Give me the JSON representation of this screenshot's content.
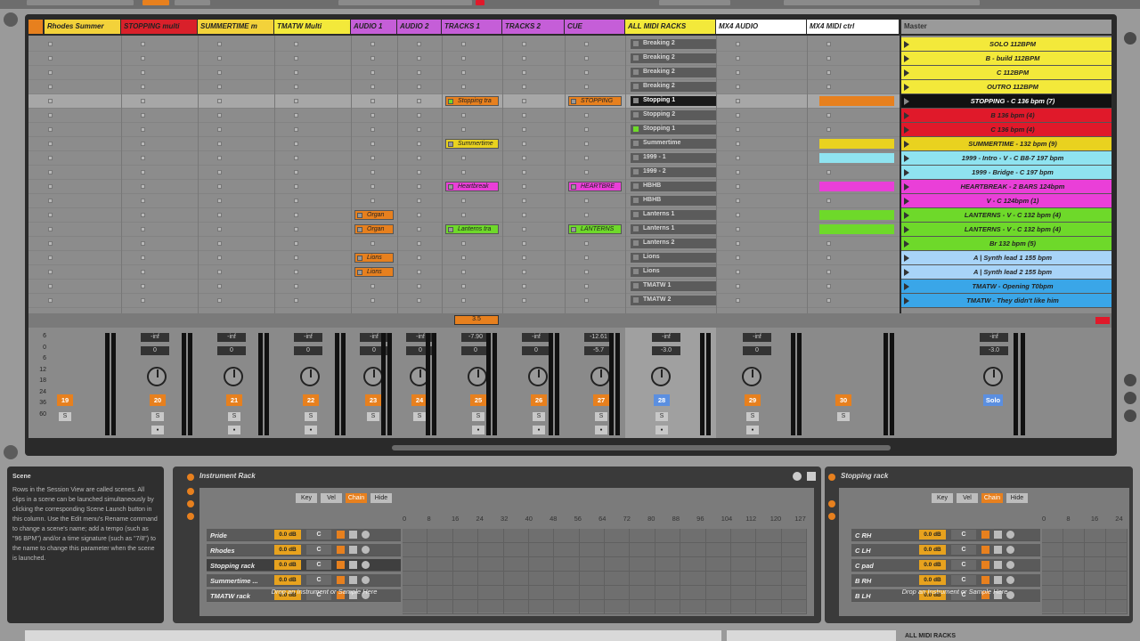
{
  "tracks": [
    {
      "name": "Rhodes Summer",
      "color": "#f3d23a",
      "num": "19",
      "vol": "",
      "pan": ""
    },
    {
      "name": "STOPPING multi",
      "color": "#d9202a",
      "num": "20",
      "vol": "-inf",
      "pan": "0"
    },
    {
      "name": "SUMMERTIME m",
      "color": "#f3d23a",
      "num": "21",
      "vol": "-inf",
      "pan": "0"
    },
    {
      "name": "TMATW Multi",
      "color": "#f3e93a",
      "num": "22",
      "vol": "-inf",
      "pan": "0"
    },
    {
      "name": "AUDIO 1",
      "color": "#c55ed8",
      "num": "23",
      "vol": "-inf",
      "pan": "0"
    },
    {
      "name": "AUDIO 2",
      "color": "#c55ed8",
      "num": "24",
      "vol": "-inf",
      "pan": "0"
    },
    {
      "name": "TRACKS 1",
      "color": "#c55ed8",
      "num": "25",
      "vol": "-7.90",
      "pan": "0"
    },
    {
      "name": "TRACKS 2",
      "color": "#c55ed8",
      "num": "26",
      "vol": "-inf",
      "pan": "0"
    },
    {
      "name": "CUE",
      "color": "#c55ed8",
      "num": "27",
      "vol": "-12.61",
      "pan": "-5.7"
    },
    {
      "name": "ALL MIDI RACKS",
      "color": "#f3e93a",
      "num": "28",
      "vol": "-inf",
      "pan": "-3.0"
    },
    {
      "name": "MX4 AUDIO",
      "color": "#ffffff",
      "num": "29",
      "vol": "-inf",
      "pan": "0"
    },
    {
      "name": "MX4 MIDI ctrl",
      "color": "#ffffff",
      "num": "30",
      "vol": "",
      "": ""
    }
  ],
  "master": {
    "label": "Master",
    "vol": "-inf",
    "pan": "-3.0",
    "solo_label": "Solo",
    "scenes": [
      {
        "name": "SOLO    112BPM",
        "color": "#f3e93a"
      },
      {
        "name": "B - build    112BPM",
        "color": "#f3e93a"
      },
      {
        "name": "C    112BPM",
        "color": "#f3e93a"
      },
      {
        "name": "OUTRO    112BPM",
        "color": "#f3e93a"
      },
      {
        "name": "STOPPING - C        136 bpm    (7)",
        "color": "#111111"
      },
      {
        "name": "B        136 bpm    (4)",
        "color": "#e0192a"
      },
      {
        "name": "C        136 bpm    (4)",
        "color": "#e0192a"
      },
      {
        "name": "SUMMERTIME -        132 bpm    (9)",
        "color": "#e9d21f"
      },
      {
        "name": "1999 - Intro - V - C        B8-7        197 bpm",
        "color": "#8fe3f0"
      },
      {
        "name": "1999 - Bridge - C        197 bpm",
        "color": "#8fe3f0"
      },
      {
        "name": "HEARTBREAK - 2 BARS        124bpm",
        "color": "#ea3fd8"
      },
      {
        "name": "V - C        124bpm    (1)",
        "color": "#ea3fd8"
      },
      {
        "name": "LANTERNS -    V - C        132 bpm    (4)",
        "color": "#6ed92a"
      },
      {
        "name": "LANTERNS -    V - C        132 bpm    (4)",
        "color": "#6ed92a"
      },
      {
        "name": "Br        132 bpm    (5)",
        "color": "#6ed92a"
      },
      {
        "name": "A | Synth lead 1        155 bpm",
        "color": "#a8d4f8"
      },
      {
        "name": "A | Synth lead 2        155 bpm",
        "color": "#a8d4f8"
      },
      {
        "name": "TMATW - Opening    T0bpm",
        "color": "#3aa6e8"
      },
      {
        "name": "TMATW - They didn't like him",
        "color": "#3aa6e8"
      }
    ]
  },
  "clips": {
    "col6": [
      {
        "row": 4,
        "label": "Stopping tra",
        "color": "#e7801e"
      },
      {
        "row": 7,
        "label": "Summertime",
        "color": "#e9d21f"
      },
      {
        "row": 10,
        "label": "Heartbreak",
        "color": "#ea3fd8"
      },
      {
        "row": 13,
        "label": "Lanterns tra",
        "color": "#6ed92a"
      }
    ],
    "col8": [
      {
        "row": 4,
        "label": "STOPPING",
        "color": "#e7801e"
      },
      {
        "row": 10,
        "label": "HEARTBRE",
        "color": "#ea3fd8"
      },
      {
        "row": 13,
        "label": "LANTERNS",
        "color": "#6ed92a"
      }
    ],
    "col4": [
      {
        "row": 12,
        "label": "Organ",
        "color": "#e7801e"
      },
      {
        "row": 13,
        "label": "Organ",
        "color": "#e7801e"
      },
      {
        "row": 15,
        "label": "Lions",
        "color": "#e7801e"
      },
      {
        "row": 16,
        "label": "Lions",
        "color": "#e7801e"
      }
    ],
    "midi": [
      {
        "row": 4,
        "color": "#e7801e"
      },
      {
        "row": 7,
        "color": "#e9d21f"
      },
      {
        "row": 8,
        "color": "#8fe3f0"
      },
      {
        "row": 10,
        "color": "#ea3fd8"
      },
      {
        "row": 12,
        "color": "#6ed92a"
      },
      {
        "row": 13,
        "color": "#6ed92a"
      }
    ],
    "racks": [
      "Breaking 2",
      "Breaking 2",
      "Breaking 2",
      "Breaking 2",
      "Stopping 1",
      "Stopping 2",
      "Stopping 1",
      "Summertime",
      "1999 - 1",
      "1999 - 2",
      "HBHB",
      "HBHB",
      "Lanterns 1",
      "Lanterns 1",
      "Lanterns 2",
      "Lions",
      "Lions",
      "TMATW 1",
      "TMATW 2"
    ]
  },
  "stop_clip_label": "3.5",
  "info": {
    "title": "Scene",
    "body": "Rows in the Session View are called scenes. All clips in a scene can be launched simultaneously by clicking the corresponding Scene Launch button in this column. Use the Edit menu's Rename command to change a scene's name; add a tempo (such as \"96 BPM\") and/or a time signature (such as \"7/8\") to the name to change this parameter when the scene is launched."
  },
  "instrument_rack": {
    "title": "Instrument Rack",
    "tabs": [
      "Key",
      "Vel",
      "Chain",
      "Hide"
    ],
    "chains": [
      "Pride",
      "Rhodes",
      "Stopping rack",
      "Summertime ...",
      "TMATW rack"
    ],
    "ruler": [
      "0",
      "8",
      "16",
      "24",
      "32",
      "40",
      "48",
      "56",
      "64",
      "72",
      "80",
      "88",
      "96",
      "104",
      "112",
      "120",
      "127"
    ],
    "drop": "Drop an Instrument or Sample Here",
    "vol": "0.0 dB",
    "pan": "C"
  },
  "stopping_rack": {
    "title": "Stopping rack",
    "tabs": [
      "Key",
      "Vel",
      "Chain",
      "Hide"
    ],
    "chains": [
      "C RH",
      "C LH",
      "C pad",
      "B RH",
      "B LH"
    ],
    "ruler": [
      "0",
      "8",
      "16",
      "24"
    ],
    "drop": "Drop an Instrument or Sample Here",
    "vol": "0.0 dB",
    "pan": "C"
  },
  "bottom_label": "ALL MIDI RACKS",
  "scale_labels": [
    "6",
    "0",
    "6",
    "12",
    "18",
    "24",
    "36",
    "60"
  ]
}
